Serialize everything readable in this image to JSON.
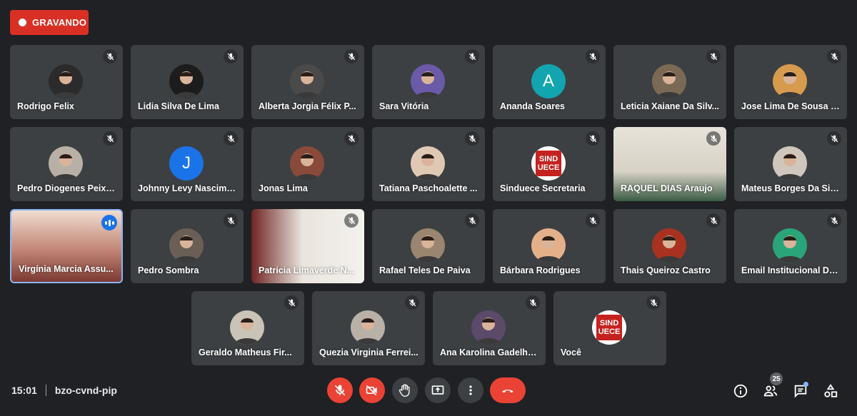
{
  "recording": {
    "label": "GRAVANDO"
  },
  "participants": [
    {
      "name": "Rodrigo Felix",
      "avatar": "photo",
      "color": "#2b2b2b"
    },
    {
      "name": "Lidia Silva De Lima",
      "avatar": "photo",
      "color": "#1c1c1c"
    },
    {
      "name": "Alberta Jorgia Félix P...",
      "avatar": "photo",
      "color": "#4a4a4a"
    },
    {
      "name": "Sara Vitória",
      "avatar": "photo",
      "color": "#6b5aa8"
    },
    {
      "name": "Ananda Soares",
      "avatar": "initial",
      "initial": "A",
      "color": "#12a4af"
    },
    {
      "name": "Leticia Xaiane Da Silv...",
      "avatar": "photo",
      "color": "#7a6a55"
    },
    {
      "name": "Jose Lima De Sousa J...",
      "avatar": "photo",
      "color": "#d79b4e"
    },
    {
      "name": "Pedro Diogenes Peixo...",
      "avatar": "photo",
      "color": "#b8b0a6"
    },
    {
      "name": "Johnny Levy Nascime...",
      "avatar": "initial",
      "initial": "J",
      "color": "#1a73e8"
    },
    {
      "name": "Jonas Lima",
      "avatar": "photo",
      "color": "#8a4a3a"
    },
    {
      "name": "Tatiana Paschoalette ...",
      "avatar": "photo",
      "color": "#e0c9b4"
    },
    {
      "name": "Sinduece Secretaria",
      "avatar": "logo",
      "color": "#c5221f"
    },
    {
      "name": "RAQUEL DIAS Araujo",
      "avatar": "video"
    },
    {
      "name": "Mateus Borges Da Silva",
      "avatar": "photo",
      "color": "#cfc7bc"
    },
    {
      "name": "Virgínia Marcia Assu...",
      "avatar": "video",
      "speaking": true
    },
    {
      "name": "Pedro Sombra",
      "avatar": "photo",
      "color": "#6a5f55"
    },
    {
      "name": "Patricia Limaverde N...",
      "avatar": "video"
    },
    {
      "name": "Rafael Teles De Paiva",
      "avatar": "photo",
      "color": "#9a8570"
    },
    {
      "name": "Bárbara Rodrigues",
      "avatar": "photo",
      "color": "#e4b08a"
    },
    {
      "name": "Thais Queiroz Castro",
      "avatar": "photo",
      "color": "#a8321f"
    },
    {
      "name": "Email Institucional Do...",
      "avatar": "photo",
      "color": "#2aa57a"
    },
    {
      "name": "Geraldo Matheus Fir...",
      "avatar": "photo",
      "color": "#c9c3b8"
    },
    {
      "name": "Quezia Virginia Ferrei...",
      "avatar": "photo",
      "color": "#b7b1a8"
    },
    {
      "name": "Ana Karolina Gadelha ...",
      "avatar": "photo",
      "color": "#5b4a6a"
    },
    {
      "name": "Você",
      "avatar": "logo",
      "color": "#c5221f"
    }
  ],
  "logo_text": {
    "line1": "SIND",
    "line2": "UECE"
  },
  "meeting": {
    "time": "15:01",
    "code": "bzo-cvnd-pip"
  },
  "people_count": "25",
  "colors": {
    "background": "#202124",
    "tile": "#3c4043",
    "danger": "#ea4335",
    "accent": "#1a73e8"
  },
  "controls": [
    "mic-off-icon",
    "camera-off-icon",
    "raise-hand-icon",
    "present-screen-icon",
    "more-options-icon",
    "end-call-icon"
  ],
  "side_icons": [
    "info-icon",
    "people-icon",
    "chat-icon",
    "activities-icon"
  ]
}
